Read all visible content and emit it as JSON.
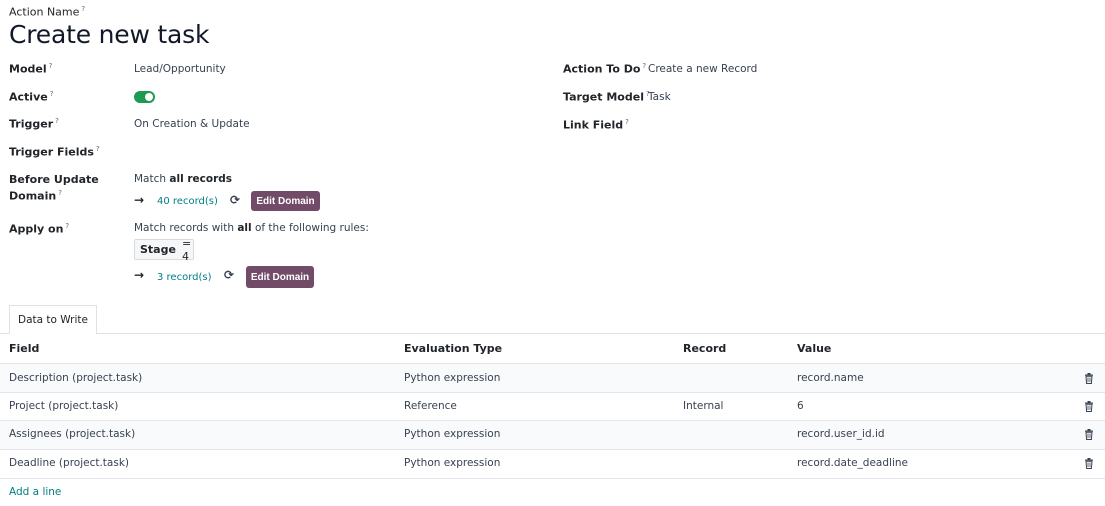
{
  "header": {
    "action_name_label": "Action Name",
    "title": "Create new task"
  },
  "help_mark": "?",
  "fields_left": {
    "model_label": "Model",
    "model_value": "Lead/Opportunity",
    "active_label": "Active",
    "active_value": true,
    "trigger_label": "Trigger",
    "trigger_value": "On Creation & Update",
    "trigger_fields_label": "Trigger Fields",
    "before_update_label_1": "Before Update",
    "before_update_label_2": "Domain",
    "before_update_match_prefix": "Match ",
    "before_update_match_bold": "all records",
    "before_update_records": "40 record(s)",
    "edit_domain_label": "Edit Domain",
    "apply_on_label": "Apply on",
    "apply_on_prefix": "Match records with ",
    "apply_on_bold": "all",
    "apply_on_suffix": " of the following rules:",
    "rule_field": "Stage",
    "rule_op_value": "= 4",
    "apply_on_records": "3 record(s)"
  },
  "fields_right": {
    "action_to_do_label": "Action To Do",
    "action_to_do_value": "Create a new Record",
    "target_model_label": "Target Model",
    "target_model_value": "Task",
    "link_field_label": "Link Field"
  },
  "tabs": [
    {
      "label": "Data to Write"
    }
  ],
  "table": {
    "columns": [
      "Field",
      "Evaluation Type",
      "Record",
      "Value"
    ],
    "rows": [
      {
        "field": "Description (project.task)",
        "type": "Python expression",
        "record": "",
        "value": "record.name"
      },
      {
        "field": "Project (project.task)",
        "type": "Reference",
        "record": "Internal",
        "value": "6"
      },
      {
        "field": "Assignees (project.task)",
        "type": "Python expression",
        "record": "",
        "value": "record.user_id.id"
      },
      {
        "field": "Deadline (project.task)",
        "type": "Python expression",
        "record": "",
        "value": "record.date_deadline"
      }
    ],
    "add_line_label": "Add a line"
  },
  "colors": {
    "accent": "#714b67",
    "link": "#017e84",
    "toggle_on": "#1e9a52"
  }
}
